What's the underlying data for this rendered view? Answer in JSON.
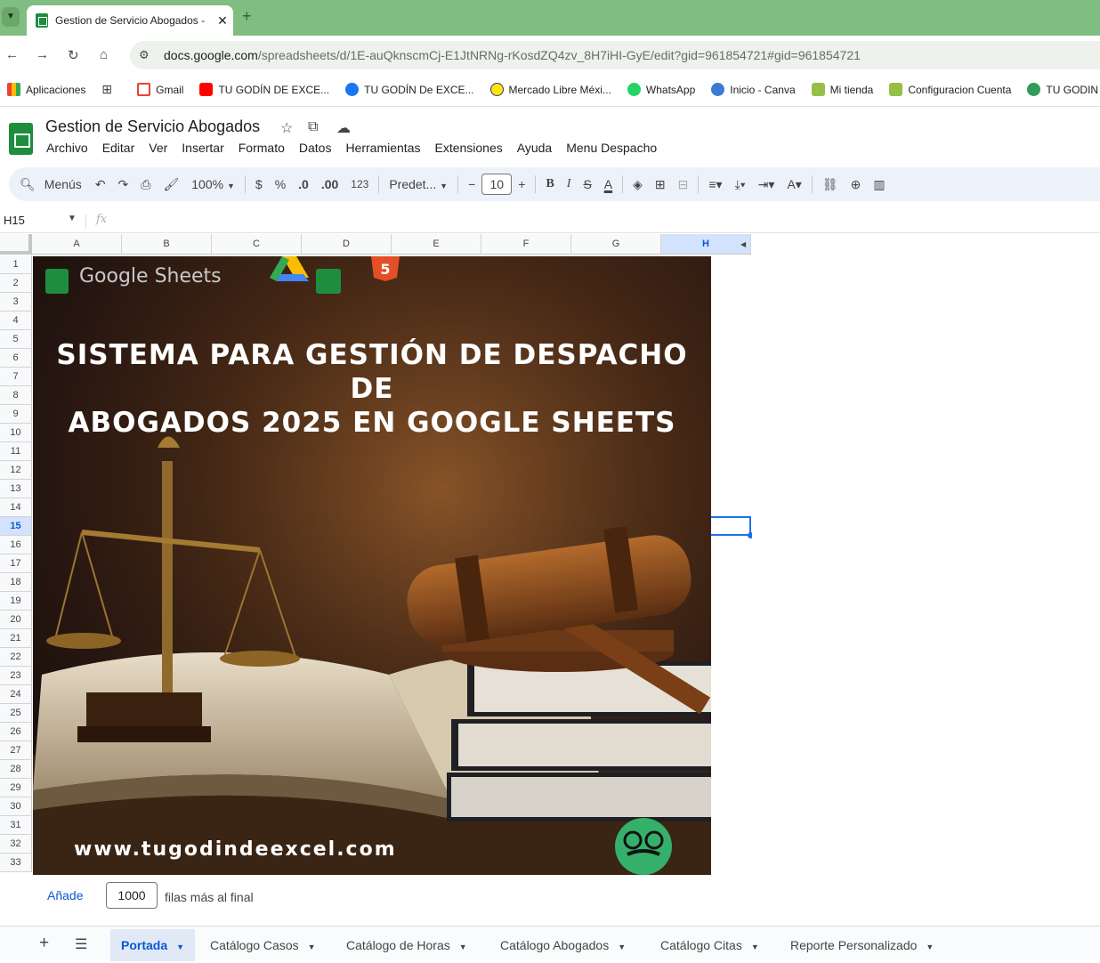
{
  "browser": {
    "tab_title": "Gestion de Servicio Abogados - ",
    "url_host": "docs.google.com",
    "url_path": "/spreadsheets/d/1E-auQknscmCj-E1JtNRNg-rKosdZQ4zv_8H7iHI-GyE/edit?gid=961854721#gid=961854721"
  },
  "bookmarks": [
    {
      "label": "Aplicaciones",
      "icon": "apps-grid-icon",
      "color": "#ea4335"
    },
    {
      "label": "Gmail",
      "icon": "gmail-icon",
      "color": "#ea4335"
    },
    {
      "label": "TU GODÍN DE EXCE...",
      "icon": "youtube-icon",
      "color": "#ff0000"
    },
    {
      "label": "TU GODÍN De EXCE...",
      "icon": "facebook-icon",
      "color": "#1877f2"
    },
    {
      "label": "Mercado Libre Méxi...",
      "icon": "mercadolibre-icon",
      "color": "#ffe600"
    },
    {
      "label": "WhatsApp",
      "icon": "whatsapp-icon",
      "color": "#25d366"
    },
    {
      "label": "Inicio - Canva",
      "icon": "canva-icon",
      "color": "#00c4cc"
    },
    {
      "label": "Mi tienda",
      "icon": "shopify-icon",
      "color": "#95bf47"
    },
    {
      "label": "Configuracion Cuenta",
      "icon": "shopify-icon",
      "color": "#95bf47"
    },
    {
      "label": "TU GODIN DE",
      "icon": "godin-icon",
      "color": "#2e9d5a"
    }
  ],
  "doc": {
    "title": "Gestion de Servicio Abogados",
    "menus": [
      "Archivo",
      "Editar",
      "Ver",
      "Insertar",
      "Formato",
      "Datos",
      "Herramientas",
      "Extensiones",
      "Ayuda",
      "Menu Despacho"
    ]
  },
  "toolbar": {
    "search_label": "Menús",
    "zoom": "100%",
    "currency": "$",
    "percent": "%",
    "dec_decrease": ".0",
    "dec_increase": ".00",
    "number_format": "123",
    "font": "Predet...",
    "font_size": "10"
  },
  "formula_bar": {
    "cell_ref": "H15",
    "fx": "fx"
  },
  "grid": {
    "columns": [
      "A",
      "B",
      "C",
      "D",
      "E",
      "F",
      "G",
      "H"
    ],
    "selected_column": "H",
    "selected_row": "15",
    "rows": [
      "1",
      "2",
      "3",
      "4",
      "5",
      "6",
      "7",
      "8",
      "9",
      "10",
      "11",
      "12",
      "13",
      "14",
      "15",
      "16",
      "17",
      "18",
      "19",
      "20",
      "21",
      "22",
      "23",
      "24",
      "25",
      "26",
      "27",
      "28",
      "29",
      "30",
      "31",
      "32",
      "33"
    ]
  },
  "banner": {
    "brand": "Google Sheets",
    "title_line1": "SISTEMA PARA GESTIÓN DE DESPACHO DE",
    "title_line2": "ABOGADOS 2025 EN GOOGLE SHEETS",
    "url": "www.tugodindeexcel.com",
    "colors": {
      "bg_dark": "#241510",
      "wood": "#8a4a1c"
    }
  },
  "add_rows": {
    "button": "Añade",
    "count": "1000",
    "suffix": "filas más al final"
  },
  "sheets": [
    {
      "label": "Portada",
      "active": true
    },
    {
      "label": "Catálogo Casos",
      "active": false
    },
    {
      "label": "Catálogo de Horas",
      "active": false
    },
    {
      "label": "Catálogo Abogados",
      "active": false
    },
    {
      "label": "Catálogo Citas",
      "active": false
    },
    {
      "label": "Reporte Personalizado",
      "active": false
    }
  ]
}
